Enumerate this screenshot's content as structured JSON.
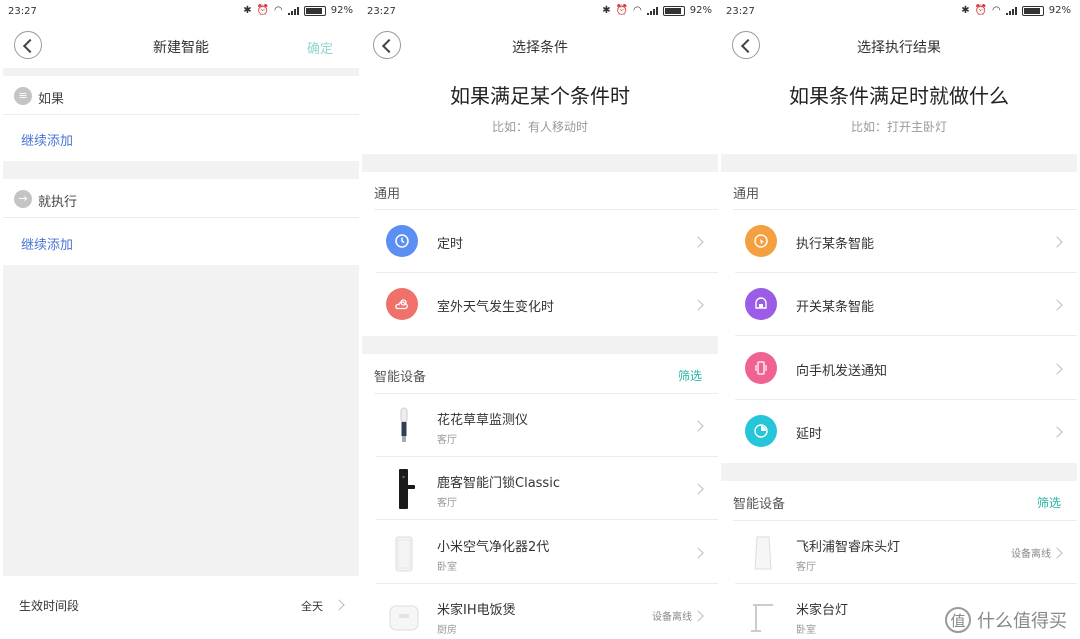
{
  "status": {
    "time": "23:27",
    "battery": "92%"
  },
  "panel1": {
    "title": "新建智能",
    "confirm": "确定",
    "if_label": "如果",
    "then_label": "就执行",
    "add_more": "继续添加",
    "period_label": "生效时间段",
    "period_value": "全天"
  },
  "panel2": {
    "title": "选择条件",
    "hero": "如果满足某个条件时",
    "hint": "比如：有人移动时",
    "general_header": "通用",
    "general_items": [
      {
        "label": "定时",
        "icon": "clock-icon",
        "color": "#5b8ff3"
      },
      {
        "label": "室外天气发生变化时",
        "icon": "weather-icon",
        "color": "#f0706a"
      }
    ],
    "devices_header": "智能设备",
    "filter": "筛选",
    "devices": [
      {
        "name": "花花草草监测仪",
        "room": "客厅",
        "status": ""
      },
      {
        "name": "鹿客智能门锁Classic",
        "room": "客厅",
        "status": ""
      },
      {
        "name": "小米空气净化器2代",
        "room": "卧室",
        "status": ""
      },
      {
        "name": "米家IH电饭煲",
        "room": "厨房",
        "status": "设备离线"
      }
    ]
  },
  "panel3": {
    "title": "选择执行结果",
    "hero": "如果条件满足时就做什么",
    "hint": "比如：打开主卧灯",
    "general_header": "通用",
    "general_items": [
      {
        "label": "执行某条智能",
        "icon": "cursor-icon",
        "color": "#f5a040"
      },
      {
        "label": "开关某条智能",
        "icon": "toggle-icon",
        "color": "#9b5de5"
      },
      {
        "label": "向手机发送通知",
        "icon": "phone-vibrate-icon",
        "color": "#f06292"
      },
      {
        "label": "延时",
        "icon": "timer-icon",
        "color": "#26c6da"
      }
    ],
    "devices_header": "智能设备",
    "filter": "筛选",
    "devices": [
      {
        "name": "飞利浦智睿床头灯",
        "room": "客厅",
        "status": "设备离线"
      },
      {
        "name": "米家台灯",
        "room": "卧室",
        "status": ""
      }
    ]
  },
  "watermark": {
    "logo": "值",
    "text": "什么值得买"
  }
}
